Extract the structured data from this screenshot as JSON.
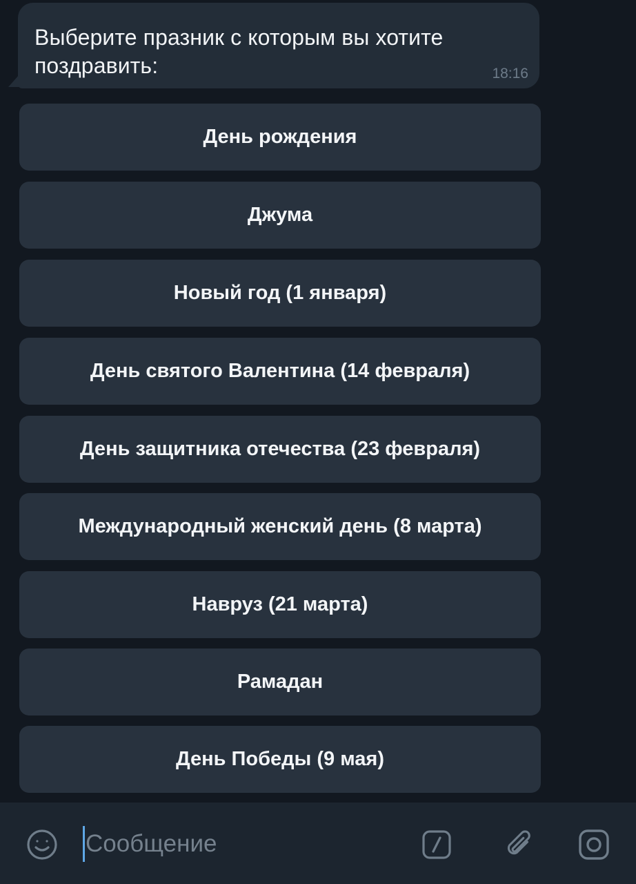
{
  "message": {
    "text": "Выберите празник с которым вы хотите поздравить:",
    "time": "18:16"
  },
  "keyboard": {
    "buttons": [
      "День рождения",
      "Джума",
      "Новый год (1 января)",
      "День святого Валентина (14 февраля)",
      "День защитника отечества (23 февраля)",
      "Международный женский день (8 марта)",
      "Навруз (21 марта)",
      "Рамадан",
      "День Победы (9 мая)"
    ]
  },
  "composer": {
    "placeholder": "Сообщение",
    "icons": {
      "emoji": "smile-icon",
      "command": "slash-command-icon",
      "attach": "paperclip-icon",
      "camera": "camera-icon"
    }
  },
  "colors": {
    "chat_background": "#121820",
    "bubble": "#232d38",
    "button": "#28323e",
    "composer": "#1c252f",
    "icon": "#6f7d8a",
    "caret": "#5ea7e6"
  }
}
